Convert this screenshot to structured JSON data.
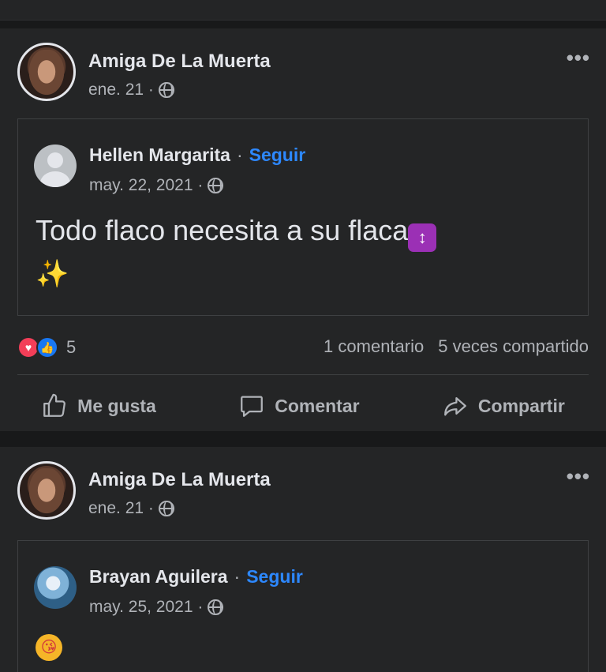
{
  "posts": [
    {
      "author": "Amiga De La Muerta",
      "date": "ene. 21 ·",
      "more": "•••",
      "shared": {
        "name": "Hellen Margarita",
        "sep": "·",
        "follow": "Seguir",
        "date": "may. 22, 2021 ·",
        "text": "Todo flaco necesita a su flaca",
        "emoji_box": "↕",
        "sparkle": "✨"
      },
      "reaction_count": "5",
      "comments": "1 comentario",
      "shares": "5 veces compartido",
      "actions": {
        "like": "Me gusta",
        "comment": "Comentar",
        "share": "Compartir"
      }
    },
    {
      "author": "Amiga De La Muerta",
      "date": "ene. 21 ·",
      "more": "•••",
      "shared": {
        "name": "Brayan Aguilera",
        "sep": "·",
        "follow": "Seguir",
        "date": "may. 25, 2021 ·",
        "emoji": "😘"
      }
    }
  ],
  "icons": {
    "globe": "globe-icon",
    "like": "thumbs-up-icon",
    "comment": "comment-bubble-icon",
    "share": "share-arrow-icon",
    "love_reaction": "heart-icon",
    "like_reaction": "like-icon"
  },
  "colors": {
    "background": "#18191a",
    "card": "#242526",
    "text": "#e4e6eb",
    "muted": "#b0b3b8",
    "link": "#2d88ff"
  }
}
